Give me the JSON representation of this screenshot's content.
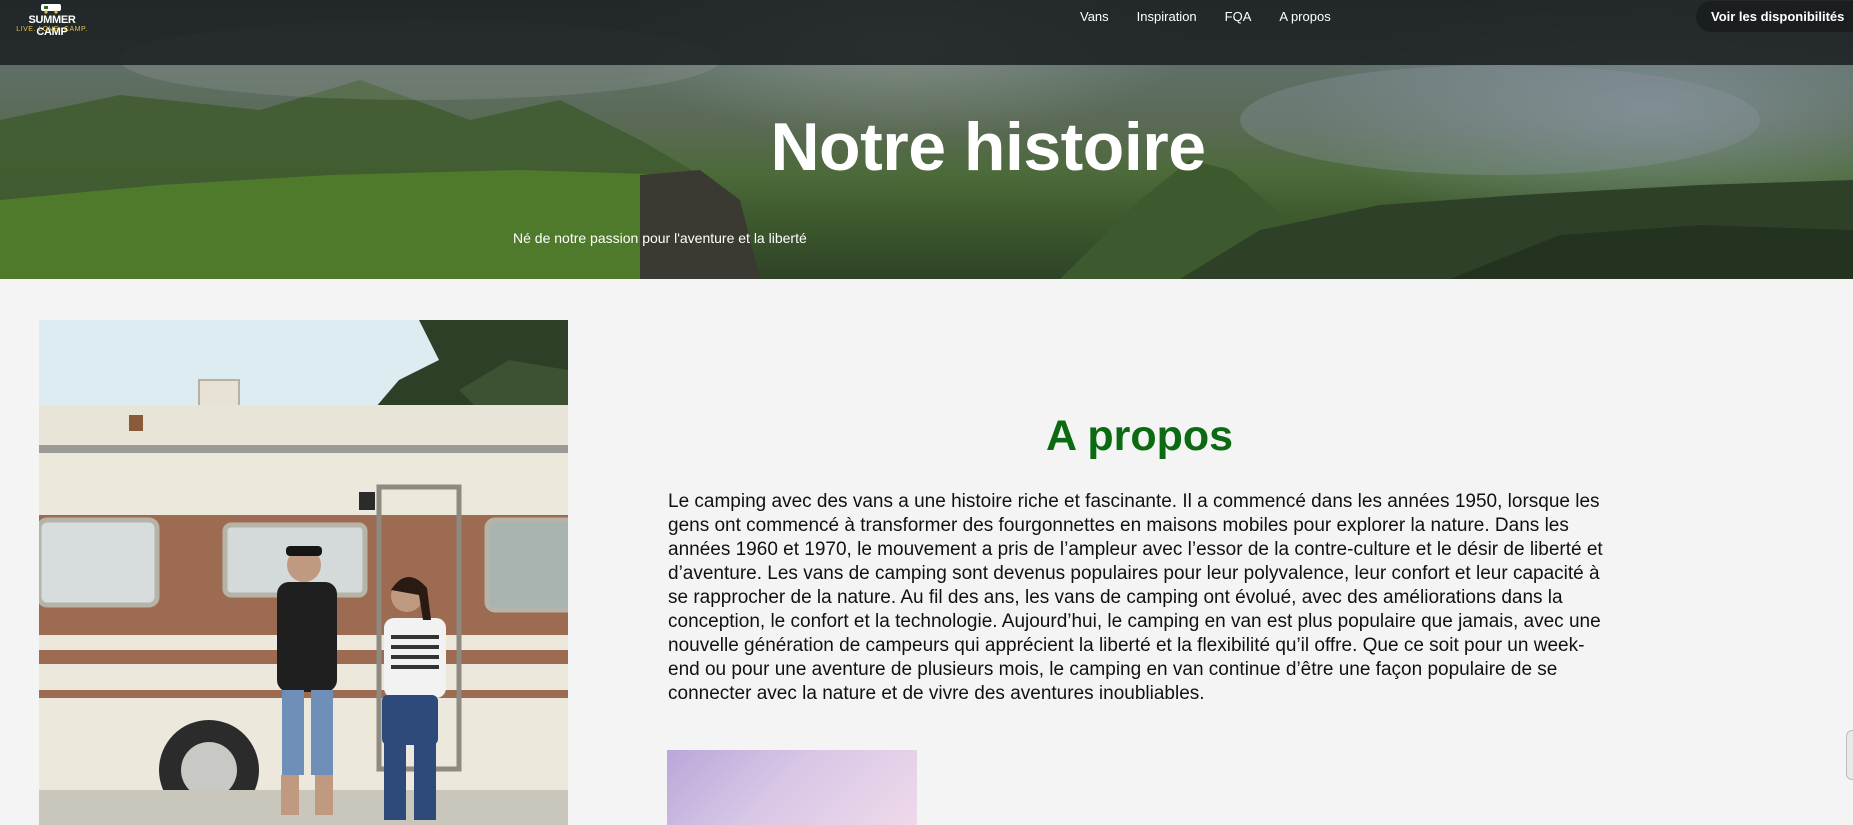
{
  "header": {
    "logo_title": "SUMMER CAMP",
    "logo_tagline": "LIVE. LOVE. CAMP.",
    "nav": [
      {
        "label": "Vans"
      },
      {
        "label": "Inspiration"
      },
      {
        "label": "FQA"
      },
      {
        "label": "A propos"
      }
    ],
    "cta_label": "Voir les disponibilités"
  },
  "hero": {
    "title": "Notre histoire",
    "subtitle": "Né de notre passion pour l'aventure et la liberté"
  },
  "about": {
    "title": "A propos",
    "body": "Le camping avec des vans a une histoire riche et fascinante. Il a commencé dans les années 1950, lorsque les gens ont commencé à transformer des fourgonnettes en maisons mobiles pour explorer la nature. Dans les années 1960 et 1970, le mouvement a pris de l’ampleur avec l’essor de la contre-culture et le désir de liberté et d’aventure. Les vans de camping sont devenus populaires pour leur polyvalence, leur confort et leur capacité à se rapprocher de la nature. Au fil des ans, les vans de camping ont évolué, avec des améliorations dans la conception, le confort et la technologie. Aujourd’hui, le camping en van est plus populaire que jamais, avec une nouvelle génération de campeurs qui apprécient la liberté et la flexibilité qu’il offre. Que ce soit pour un week-end ou pour une aventure de plusieurs mois, le camping en van continue d’être une façon populaire de se connecter avec la nature et de vivre des aventures inoubliables."
  },
  "colors": {
    "accent_green": "#0b6a12",
    "topbar_bg": "#1c2123",
    "cta_bg": "#1b1e1f",
    "page_bg": "#f4f4f4"
  }
}
